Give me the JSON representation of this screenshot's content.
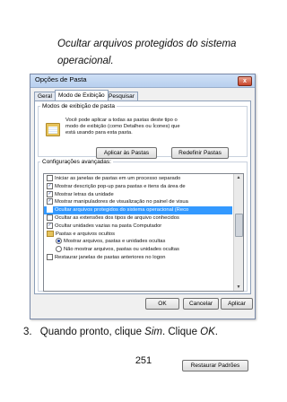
{
  "intro_text": "Ocultar arquivos protegidos do sistema operacional.",
  "dialog": {
    "title": "Opções de Pasta",
    "close_label": "x",
    "tabs": [
      "Geral",
      "Modo de Exibição",
      "Pesquisar"
    ],
    "active_tab_index": 1,
    "folder_view": {
      "legend": "Modos de exibição de pasta",
      "description": "Você pode aplicar a todas as pastas deste tipo o modo de exibição (como Detalhes ou Ícones) que está usando para esta pasta.",
      "apply_button": "Aplicar às Pastas",
      "reset_button": "Redefinir Pastas"
    },
    "advanced": {
      "legend": "Configurações avançadas:",
      "items": [
        {
          "type": "checkbox",
          "checked": false,
          "label": "Iniciar as janelas de pastas em um processo separado"
        },
        {
          "type": "checkbox",
          "checked": true,
          "label": "Mostrar descrição pop-up para pastas e itens da área de"
        },
        {
          "type": "checkbox",
          "checked": true,
          "label": "Mostrar letras da unidade"
        },
        {
          "type": "checkbox",
          "checked": true,
          "label": "Mostrar manipuladores de visualização no painel de visua"
        },
        {
          "type": "checkbox",
          "checked": false,
          "label": "Ocultar arquivos protegidos do sistema operacional (Reco",
          "selected": true
        },
        {
          "type": "checkbox",
          "checked": false,
          "label": "Ocultar as extensões dos tipos de arquivo conhecidos"
        },
        {
          "type": "checkbox",
          "checked": true,
          "label": "Ocultar unidades vazias na pasta Computador"
        },
        {
          "type": "folder",
          "label": "Pastas e arquivos ocultos"
        },
        {
          "type": "radio",
          "checked": true,
          "label": "Mostrar arquivos, pastas e unidades ocultas"
        },
        {
          "type": "radio",
          "checked": false,
          "label": "Não mostrar arquivos, pastas ou unidades ocultas"
        },
        {
          "type": "checkbox",
          "checked": false,
          "label": "Restaurar janelas de pastas anteriores no logon"
        }
      ],
      "scroll_up": "▲",
      "scroll_down": "▼"
    },
    "restore_button": "Restaurar Padrões",
    "ok_button": "OK",
    "cancel_button": "Cancelar",
    "apply_button": "Aplicar"
  },
  "step_number": "3.",
  "step_text_before": "Quando pronto, clique ",
  "step_sim": "Sim",
  "step_text_middle": ". Clique ",
  "step_ok": "OK",
  "step_text_after": ".",
  "page_number": "251",
  "colors": {
    "selection": "#3399ff",
    "title_gradient": "#b7cfee"
  }
}
